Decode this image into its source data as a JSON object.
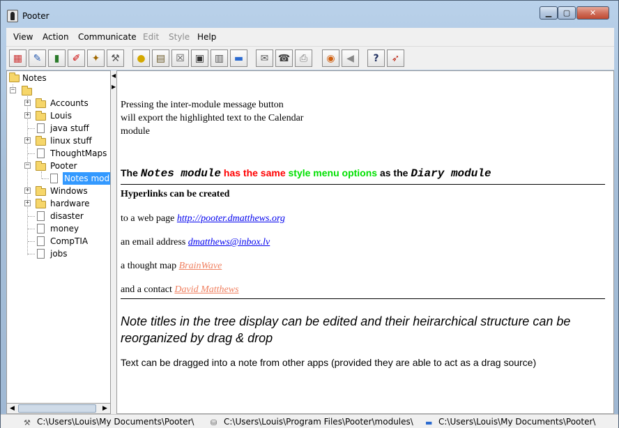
{
  "window": {
    "title": "Pooter"
  },
  "menu": [
    {
      "label": "View",
      "enabled": true
    },
    {
      "label": "Action",
      "enabled": true
    },
    {
      "label": "Communicate",
      "enabled": true
    },
    {
      "label": "Edit",
      "enabled": false
    },
    {
      "label": "Style",
      "enabled": false
    },
    {
      "label": "Help",
      "enabled": true
    }
  ],
  "toolbar": {
    "icons": [
      "calendar-icon",
      "notes-icon",
      "book-icon",
      "pen-icon",
      "wand-icon",
      "tools-icon",
      "lightbulb-icon",
      "paste-icon",
      "delete-doc-icon",
      "save-icon",
      "trash-icon",
      "open-folder-icon",
      "email-icon",
      "phone-icon",
      "fax-icon",
      "browser-icon",
      "back-icon",
      "help-icon",
      "rocket-icon"
    ]
  },
  "tree": {
    "root_label": "Notes",
    "items": [
      "Accounts",
      "Louis",
      "java stuff",
      "linux stuff",
      "ThoughtMaps",
      "Pooter",
      "Notes modu",
      "Windows",
      "hardware",
      "disaster",
      "money",
      "CompTIA",
      "jobs"
    ]
  },
  "content": {
    "intro_lines": [
      "Pressing the inter-module message button",
      "will export the highlighted text to the Calendar",
      "module"
    ],
    "heading": {
      "part1": "The ",
      "notes_module": "Notes module",
      "part2": " has the same ",
      "style_menu": "style menu options",
      "part3": " as the ",
      "diary_module": "Diary module"
    },
    "hyperlinks_title": "Hyperlinks can be created",
    "web_prefix": "to a web page ",
    "web_link": "http://pooter.dmatthews.org",
    "email_prefix": "an email address ",
    "email_link": "dmatthews@inbox.lv ",
    "thought_prefix": "a thought map ",
    "thought_link": "BrainWave",
    "contact_prefix": "and a contact ",
    "contact_link": "David Matthews",
    "italic_para": [
      "Note titles in the tree display can be edited and their heirarchical structure can be",
      "reorganized by drag & drop"
    ],
    "drag_para": "Text can be dragged into a note from other apps (provided they are able to act as a drag source)"
  },
  "status": {
    "seg1": "C:\\Users\\Louis\\My Documents\\Pooter\\",
    "seg2": "C:\\Users\\Louis\\Program Files\\Pooter\\modules\\",
    "seg3": "C:\\Users\\Louis\\My Documents\\Pooter\\"
  },
  "colors": {
    "heading_red": "#ff0000",
    "heading_green": "#00e000",
    "link_blue": "#0000ee",
    "link_salmon": "#f08060",
    "selection": "#3399ff"
  }
}
